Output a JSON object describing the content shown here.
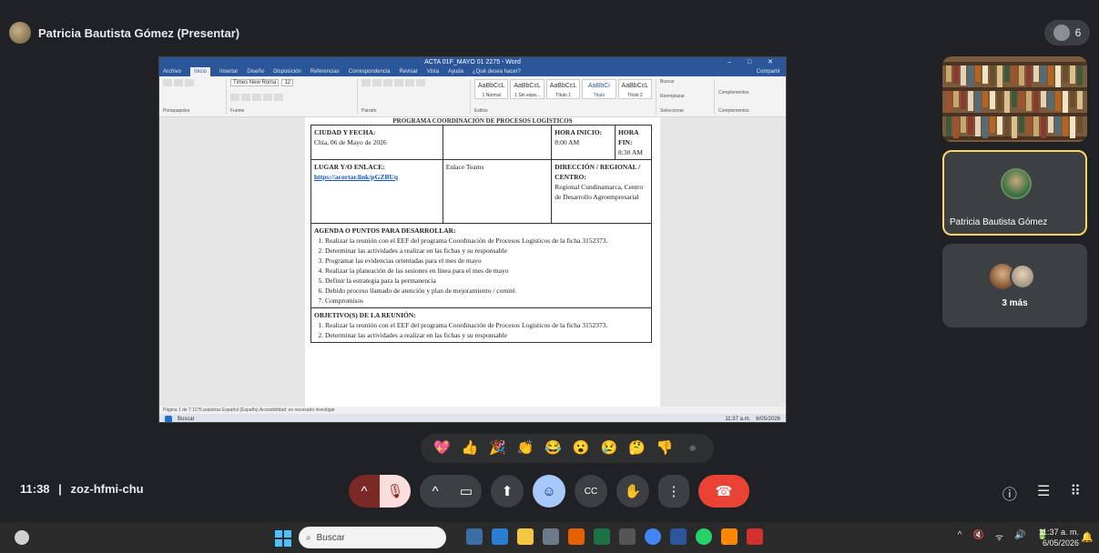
{
  "header": {
    "presenter": "Patricia Bautista Gómez (Presentar)",
    "people_count": "6"
  },
  "shared_doc": {
    "window_title": "ACTA 01F_MAYO 01 2275 - Word",
    "tabs": [
      "Archivo",
      "Inicio",
      "Insertar",
      "Diseño",
      "Disposición",
      "Referencias",
      "Correspondencia",
      "Revisar",
      "Vista",
      "Ayuda",
      "¿Qué desea hacer?"
    ],
    "share_btn": "Compartir",
    "font_name": "Times New Roma",
    "font_size": "12",
    "styles": [
      "AaBbCcL",
      "AaBbCcL",
      "AaBbCcL",
      "AaBbCi",
      "AaBbCcL"
    ],
    "style_names": [
      "1 Normal",
      "1 Sin espa...",
      "Título 1",
      "Título",
      "Título 2"
    ],
    "ribbon_groups": [
      "Portapapeles",
      "Fuente",
      "Párrafo",
      "Estilos",
      "Edición",
      "Complementos"
    ],
    "ribbon_edit": [
      "Buscar",
      "Reemplazar",
      "Seleccionar"
    ],
    "complementos": "Complementos",
    "doc_header": "PROGRAMA COORDINACIÓN DE PROCESOS LOGÍSTICOS",
    "ciudad_label": "CIUDAD Y FECHA:",
    "ciudad_value": "Chía, 06 de Mayo de 2026",
    "hora_inicio_label": "HORA INICIO:",
    "hora_inicio_value": "8:00 AM",
    "hora_fin_label": "HORA FIN:",
    "hora_fin_value": "8:30 AM",
    "lugar_label": "LUGAR Y/O ENLACE:",
    "lugar_link": "https://acortar.link/pGZBUq",
    "enlace": "Enlace Teams",
    "direccion_label": "DIRECCIÓN / REGIONAL / CENTRO:",
    "direccion_value": "Regional Cundinamarca, Centro de Desarrollo Agroempresarial",
    "agenda_title": "AGENDA O PUNTOS PARA DESARROLLAR:",
    "agenda": [
      "Realizar la reunión con el EEF del programa Coordinación de Procesos Logísticos de la ficha 3152373.",
      "Determinar las actividades a realizar en las fichas y su responsable",
      "Programar las evidencias orientadas para el mes de mayo",
      "Realizar la planeación de las sesiones en línea para el mes de mayo",
      "Definir la estrategia para la permanencia",
      "Debido proceso llamado de atención y plan de mejoramiento / comité.",
      "Compromisos"
    ],
    "objetivos_title": "OBJETIVO(S) DE LA REUNIÓN:",
    "objetivos": [
      "Realizar la reunión con el EEF del programa Coordinación de Procesos Logísticos de la ficha 3152373.",
      "Determinar las actividades a realizar en las fichas y su responsable"
    ],
    "status_bar": "Página 1 de 7    1175 palabras    Español (España)    Accesibilidad: es necesario investigar",
    "inner_search": "Buscar",
    "inner_clock": "11:37 a.m.",
    "inner_date": "6/05/2026",
    "inner_zoom": "120%"
  },
  "tiles": {
    "patricia_name": "Patricia Bautista Gómez",
    "more_label": "3 más"
  },
  "reactions": [
    "💖",
    "👍",
    "🎉",
    "👏",
    "😂",
    "😮",
    "😢",
    "🤔",
    "👎",
    "●"
  ],
  "meeting": {
    "time": "11:38",
    "separator": "|",
    "code": "zoz-hfmi-chu"
  },
  "controls": {
    "chevron": "^",
    "mic": "🎙",
    "camera": "▭",
    "present": "⬆",
    "emoji": "☺",
    "captions": "CC",
    "hand": "✋",
    "more": "⋮",
    "end": "☎"
  },
  "right_icons": [
    "ⓘ",
    "☰",
    "⠿"
  ],
  "taskbar": {
    "search": "Buscar",
    "clock": "11:37 a. m.",
    "date": "6/05/2026",
    "tray": [
      "^",
      "🔇",
      "ᯤ",
      "🔊",
      "🔋"
    ]
  }
}
